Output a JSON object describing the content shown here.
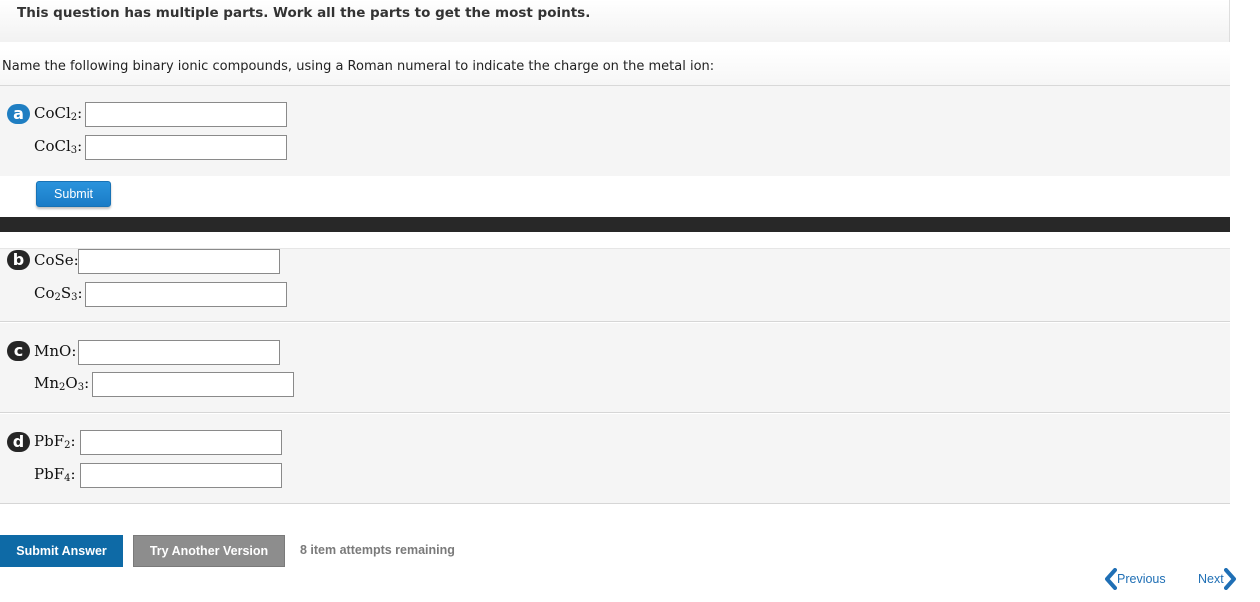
{
  "banner": {
    "text": "This question has multiple parts. Work all the parts to get the most points."
  },
  "instruction": "Name the following binary ionic compounds, using a Roman numeral to indicate the charge on the metal ion:",
  "parts": [
    {
      "letter": "a",
      "rows": [
        {
          "base1": "CoCl",
          "sub1": "2",
          "suffix": ":",
          "value": ""
        },
        {
          "base1": "CoCl",
          "sub1": "3",
          "suffix": ":",
          "value": ""
        }
      ],
      "submit_label": "Submit"
    },
    {
      "letter": "b",
      "rows": [
        {
          "base1": "CoSe",
          "suffix": ":",
          "value": ""
        },
        {
          "base1": "Co",
          "sub1": "2",
          "base2": "S",
          "sub2": "3",
          "suffix": ":",
          "value": ""
        }
      ]
    },
    {
      "letter": "c",
      "rows": [
        {
          "base1": "MnO",
          "suffix": ":",
          "value": ""
        },
        {
          "base1": "Mn",
          "sub1": "2",
          "base2": "O",
          "sub2": "3",
          "suffix": ":",
          "value": ""
        }
      ]
    },
    {
      "letter": "d",
      "rows": [
        {
          "base1": "PbF",
          "sub1": "2",
          "suffix": ":",
          "value": ""
        },
        {
          "base1": "PbF",
          "sub1": "4",
          "suffix": ":",
          "value": ""
        }
      ]
    }
  ],
  "actions": {
    "submit_answer": "Submit Answer",
    "try_another": "Try Another Version",
    "attempts": "8 item attempts remaining"
  },
  "nav": {
    "previous": "Previous",
    "next": "Next"
  },
  "colors": {
    "accent": "#1f7ec2",
    "submit_answer": "#0e6aa6",
    "badge_dark": "#262626",
    "link": "#1f6fb5"
  },
  "icons": {
    "previous": "chevron-left-icon",
    "next": "chevron-right-icon"
  }
}
